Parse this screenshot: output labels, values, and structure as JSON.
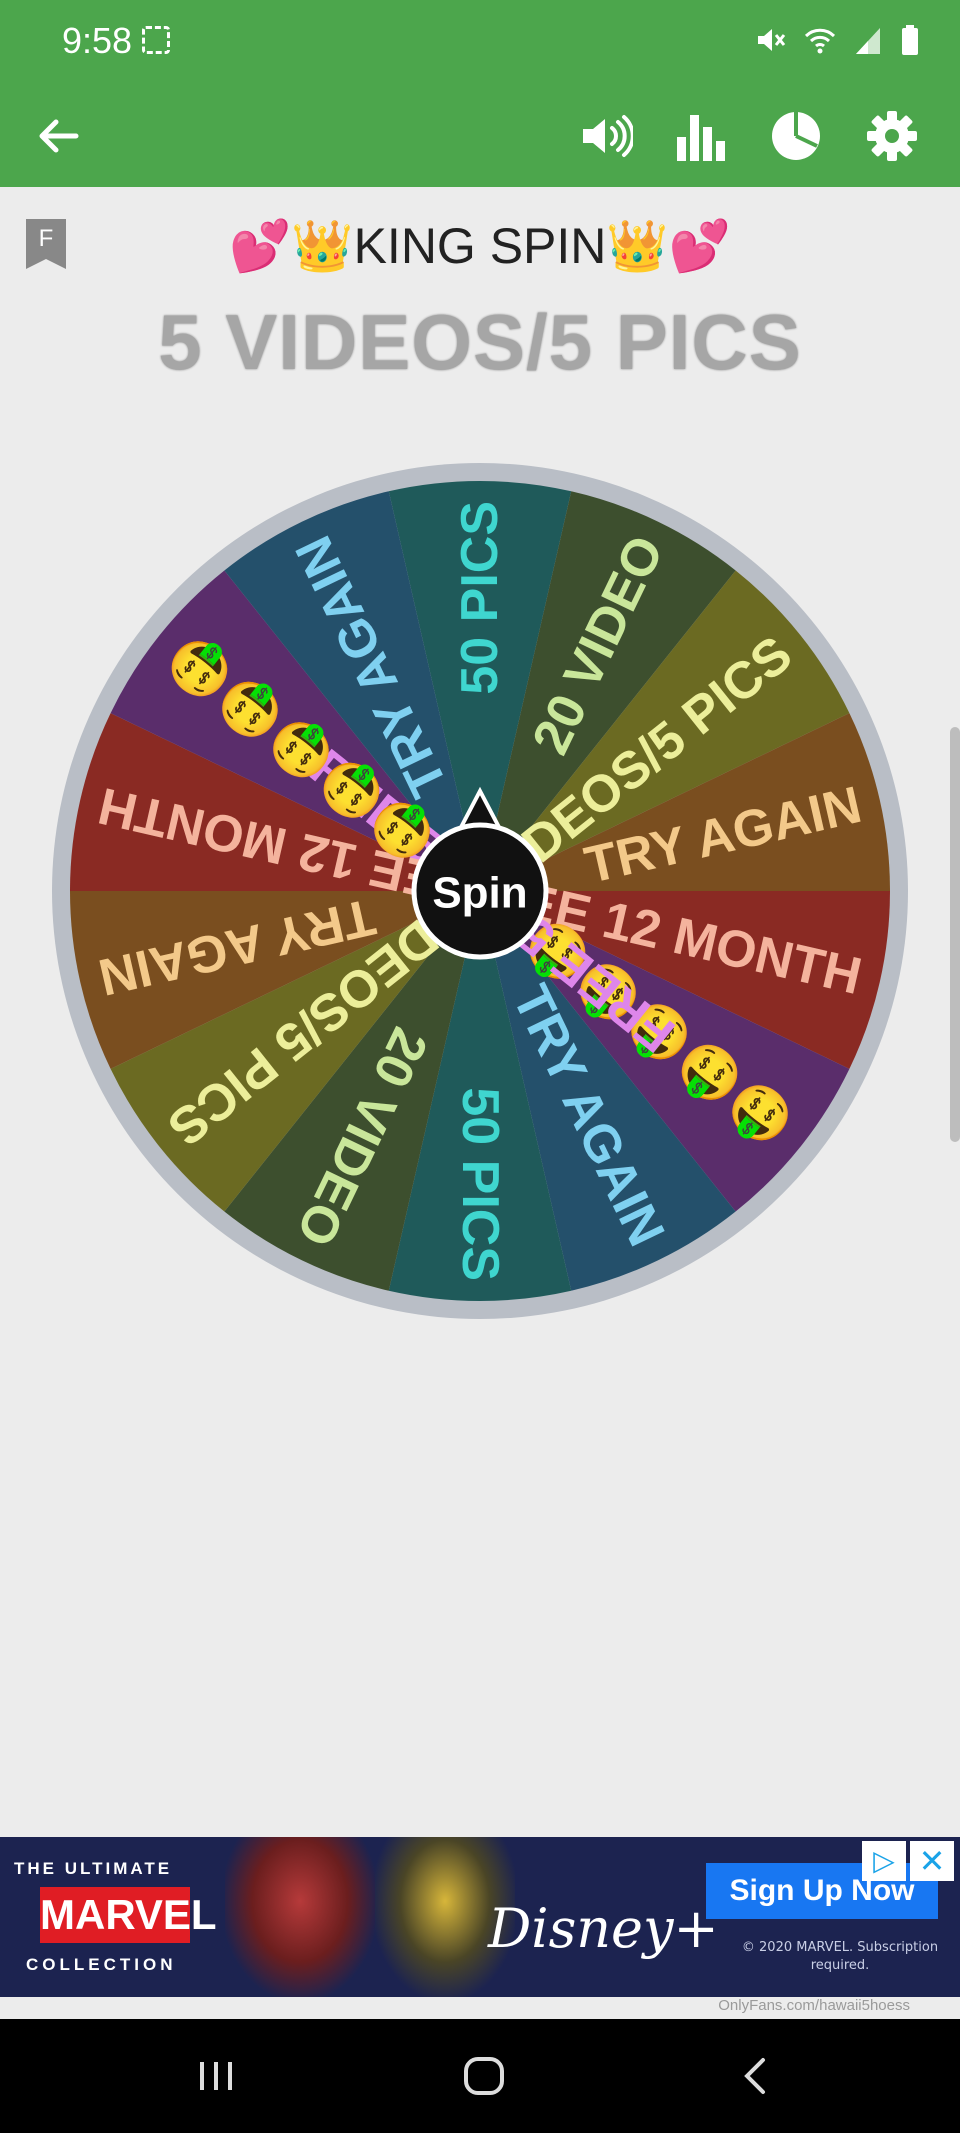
{
  "status_bar": {
    "time": "9:58"
  },
  "app_bar": {
    "icons": [
      "back-arrow-icon",
      "volume-icon",
      "bar-chart-icon",
      "pie-chart-icon",
      "gear-icon"
    ]
  },
  "header": {
    "title": "💕👑KING SPIN👑💕",
    "subtitle": "5 VIDEOS/5 PICS",
    "filter_tag": "F"
  },
  "wheel": {
    "center_label": "Spin",
    "segments": [
      {
        "label": "50 PICS",
        "color": "#1f5a5a",
        "text_color": "#3fd6cf"
      },
      {
        "label": "20 VIDEO",
        "color": "#3d4f2e",
        "text_color": "#c9e69a"
      },
      {
        "label": "5 VIDEOS/5 PICS",
        "color": "#6b6a22",
        "text_color": "#ecee9a"
      },
      {
        "label": "TRY AGAIN",
        "color": "#7a4e1f",
        "text_color": "#f3c98a"
      },
      {
        "label": "FREE 12 MONTH",
        "color": "#8a2a23",
        "text_color": "#f4b39d"
      },
      {
        "label": "FREE 5 MIN 🤑🤑🤑🤑🤑",
        "color": "#5a2d6b",
        "text_color": "#de86ea"
      },
      {
        "label": "TRY AGAIN",
        "color": "#24506b",
        "text_color": "#7fd0f0"
      },
      {
        "label": "50 PICS",
        "color": "#1f5a5a",
        "text_color": "#3fd6cf"
      },
      {
        "label": "20 VIDEO",
        "color": "#3d4f2e",
        "text_color": "#c9e69a"
      },
      {
        "label": "5 VIDEOS/5 PICS",
        "color": "#6b6a22",
        "text_color": "#ecee9a"
      },
      {
        "label": "TRY AGAIN",
        "color": "#7a4e1f",
        "text_color": "#f3c98a"
      },
      {
        "label": "FREE 12 MONTH",
        "color": "#8a2a23",
        "text_color": "#f4b39d"
      },
      {
        "label": "FREE 5 MIN 🤑🤑🤑🤑🤑",
        "color": "#5a2d6b",
        "text_color": "#de86ea"
      },
      {
        "label": "TRY AGAIN",
        "color": "#24506b",
        "text_color": "#7fd0f0"
      }
    ]
  },
  "ad": {
    "top_line": "THE ULTIMATE",
    "brand": "MARVEL",
    "bottom_line": "COLLECTION",
    "streaming": "Disney+",
    "cta": "Sign Up Now",
    "fine_print": "© 2020 MARVEL. Subscription required."
  },
  "watermark": "OnlyFans.com/hawaii5hoess",
  "nav_bar": {
    "icons": [
      "recents-icon",
      "home-icon",
      "back-icon"
    ]
  },
  "colors": {
    "accent": "#4ca64c",
    "background": "#ececec"
  }
}
